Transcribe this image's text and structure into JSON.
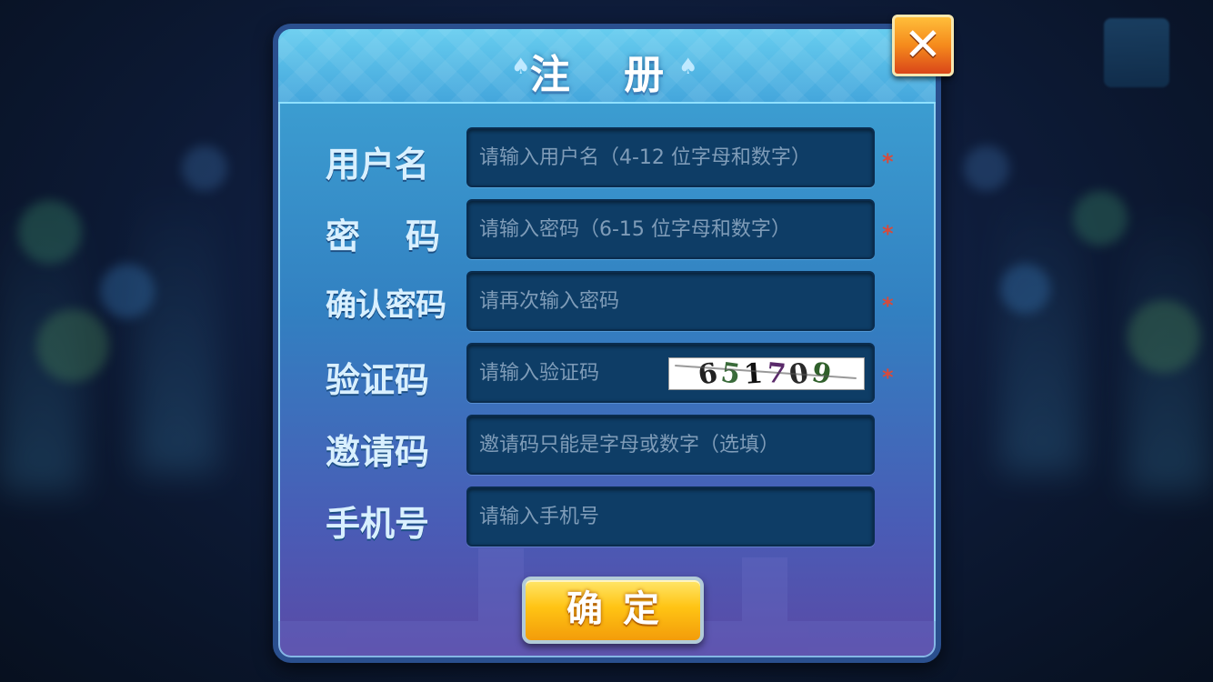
{
  "dialog": {
    "title": "注 册",
    "close_icon": "close-icon"
  },
  "fields": [
    {
      "label": "用户名",
      "placeholder": "请输入用户名（4-12 位字母和数字）",
      "required": "*"
    },
    {
      "label": "密码",
      "placeholder": "请输入密码（6-15 位字母和数字）",
      "required": "*"
    },
    {
      "label": "确认密码",
      "placeholder": "请再次输入密码",
      "required": "*"
    },
    {
      "label": "验证码",
      "placeholder": "请输入验证码",
      "required": "*",
      "captcha": [
        "6",
        "5",
        "1",
        "7",
        "0",
        "9"
      ]
    },
    {
      "label": "邀请码",
      "placeholder": "邀请码只能是字母或数字（选填）"
    },
    {
      "label": "手机号",
      "placeholder": "请输入手机号"
    }
  ],
  "confirm_label": "确定",
  "colors": {
    "accent": "#ffc414",
    "required": "#d84a3a",
    "field_bg": "#0e3d66"
  }
}
